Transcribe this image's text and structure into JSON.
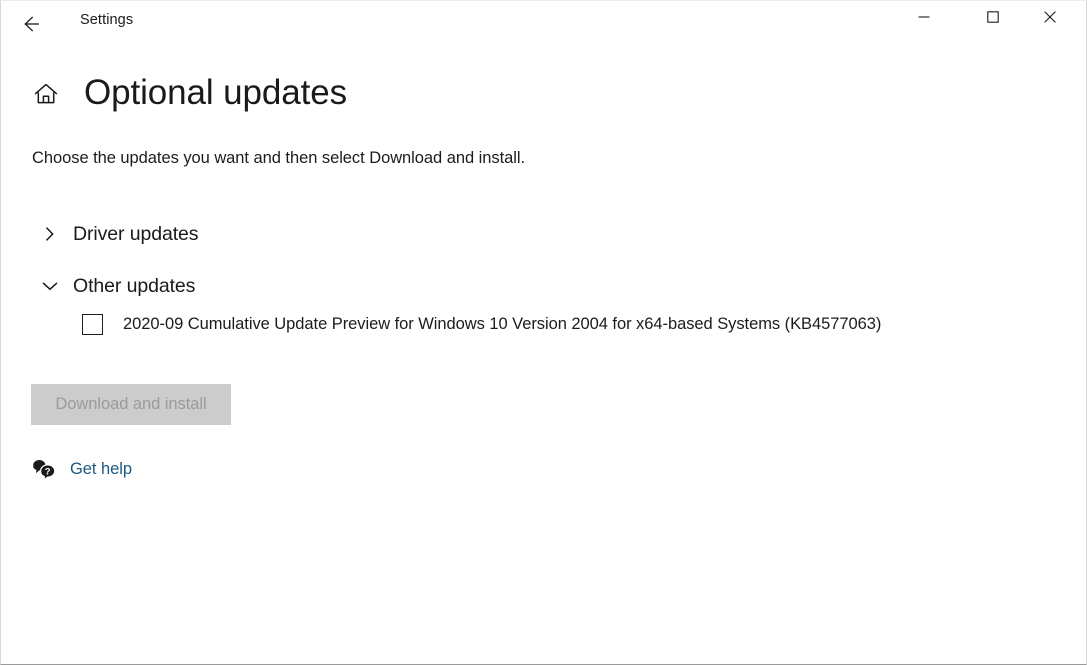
{
  "window": {
    "titlebar": {
      "title": "Settings",
      "back_icon": "back-arrow-icon",
      "minimize_label": "–",
      "maximize_label": "□",
      "close_label": "✕"
    }
  },
  "header": {
    "home_icon": "home-icon",
    "title": "Optional updates"
  },
  "main": {
    "subtitle": "Choose the updates you want and then select Download and install.",
    "groups": [
      {
        "label": "Driver updates",
        "expanded": false,
        "chevron_icon": "chevron-right-icon",
        "items": []
      },
      {
        "label": "Other updates",
        "expanded": true,
        "chevron_icon": "chevron-down-icon",
        "items": [
          {
            "label": "2020-09 Cumulative Update Preview for Windows 10 Version 2004 for x64-based Systems (KB4577063)",
            "checked": false
          }
        ]
      }
    ],
    "download_button": {
      "label": "Download and install",
      "enabled": false
    },
    "get_help": {
      "label": "Get help",
      "icon": "help-chat-bubble-icon"
    }
  },
  "colors": {
    "background": "#ffffff",
    "text": "#1c1c1c",
    "link": "#1b5a80",
    "disabled_button_bg": "#cccccc",
    "disabled_button_text": "#9b9b9b"
  }
}
